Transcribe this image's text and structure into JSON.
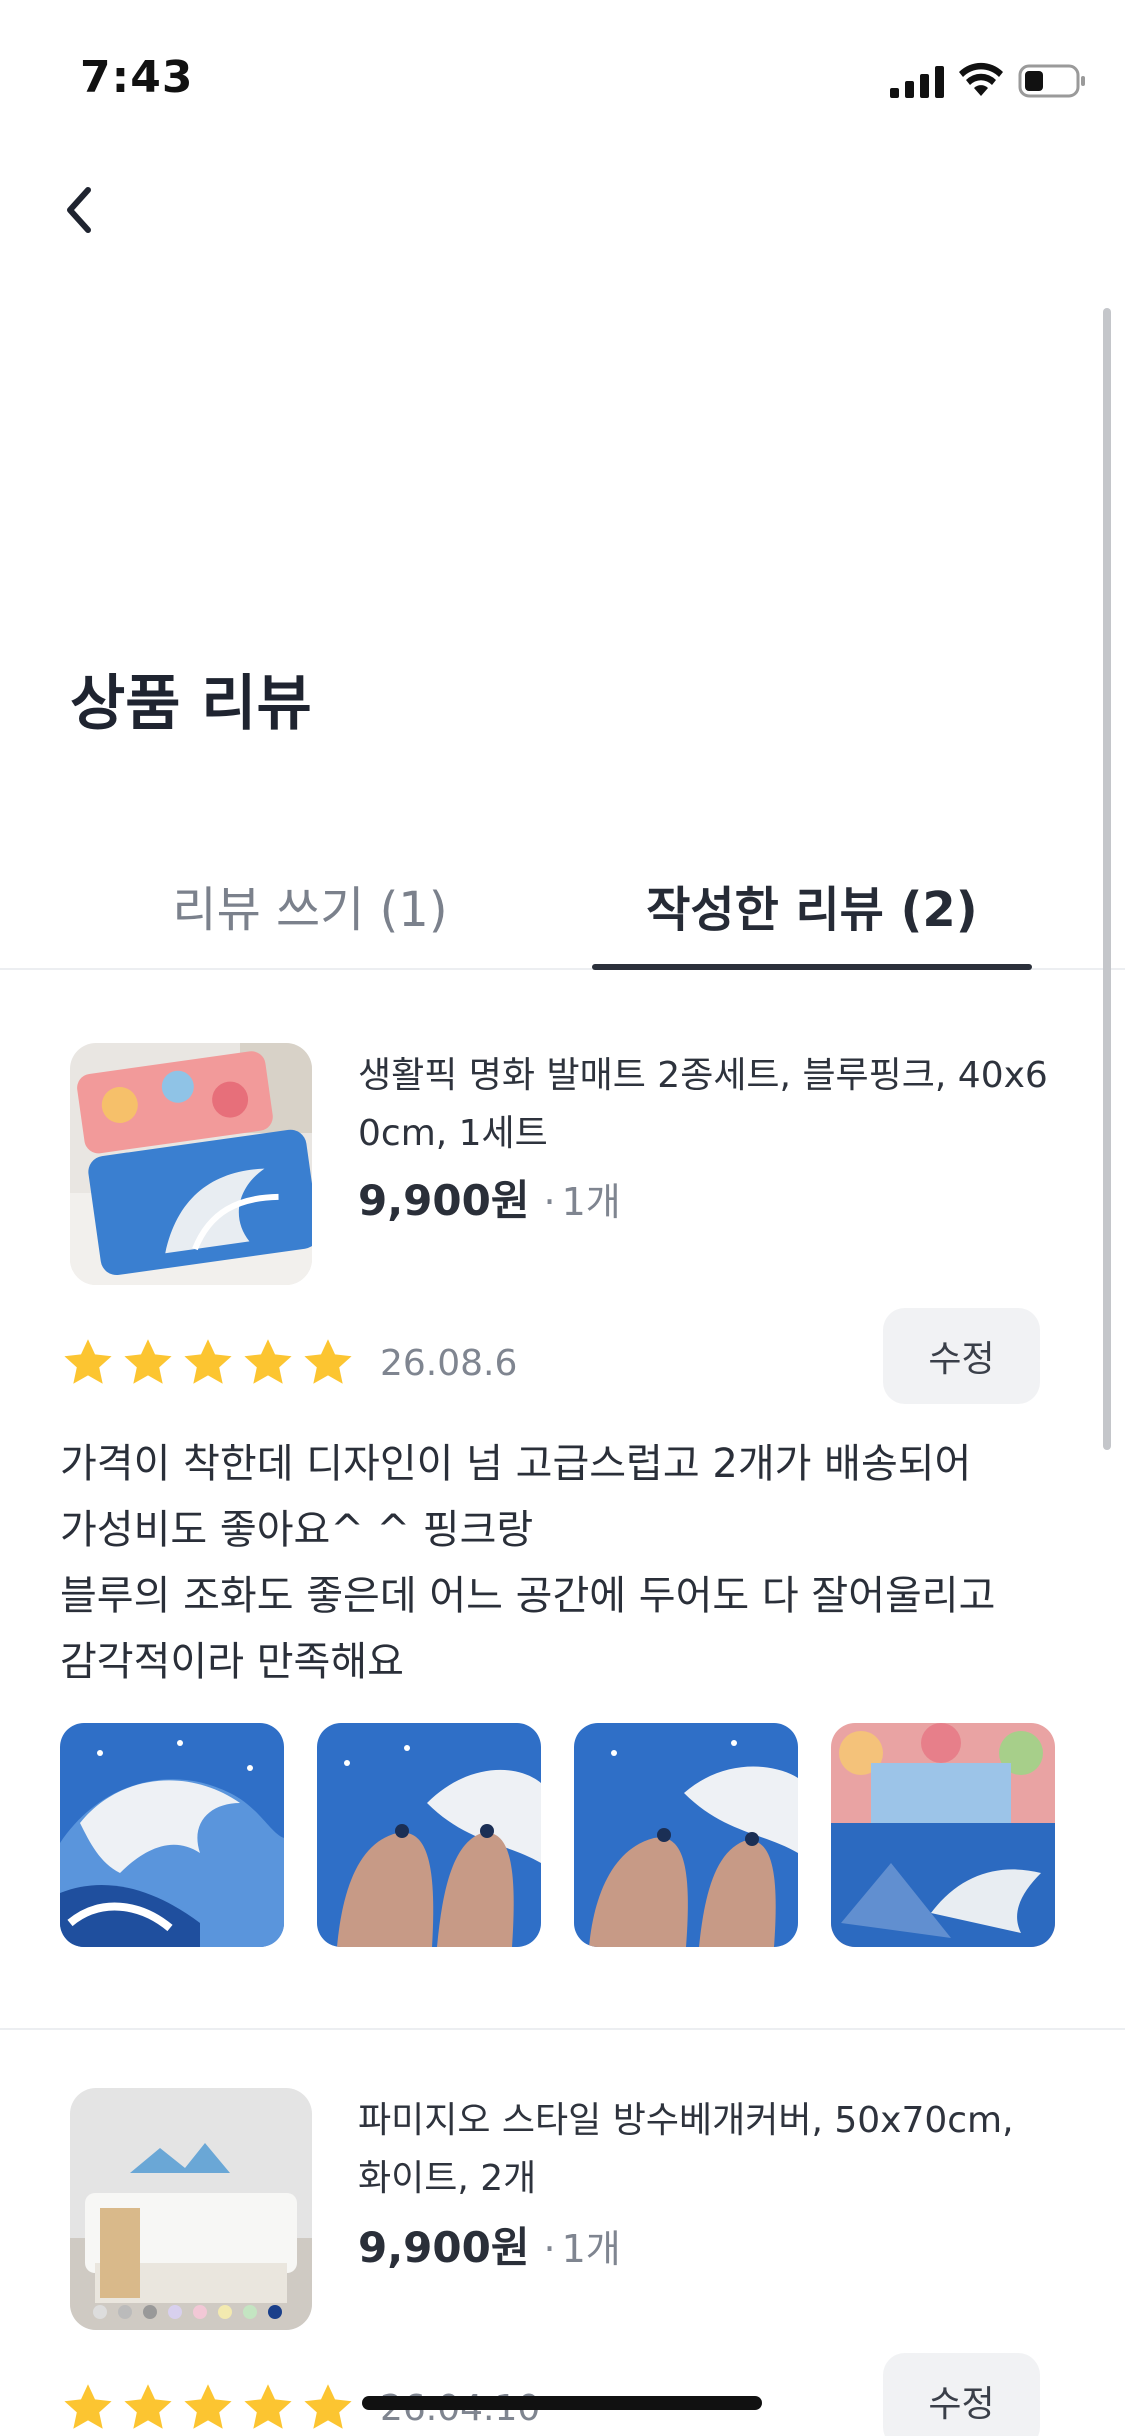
{
  "status_bar": {
    "time": "7:43"
  },
  "page_title": "상품 리뷰",
  "tabs": [
    {
      "label": "리뷰 쓰기 (1)",
      "active": false
    },
    {
      "label": "작성한 리뷰 (2)",
      "active": true
    }
  ],
  "reviews": [
    {
      "product_name": "생활픽 명화 발매트 2종세트, 블루핑크, 40x60cm, 1세트",
      "price": "9,900원",
      "quantity": "1개",
      "rating": 5,
      "date": "26.08.6",
      "edit_label": "수정",
      "text_lines": [
        "가격이 착한데 디자인이 넘 고급스럽고 2개가 배송되어",
        "가성비도 좋아요^ ^ 핑크랑",
        "블루의 조화도 좋은데 어느 공간에 두어도 다 잘어울리고",
        "감각적이라 만족해요"
      ],
      "photo_count": 4
    },
    {
      "product_name": "파미지오 스타일 방수베개커버, 50x70cm, 화이트, 2개",
      "price": "9,900원",
      "quantity": "1개",
      "rating": 5,
      "date": "26.04.10",
      "edit_label": "수정"
    }
  ],
  "colors": {
    "star": "#fcc531",
    "tab_indicator": "#2b303b",
    "muted_text": "#7f8590",
    "edit_button_bg": "#f1f2f4"
  },
  "icons": [
    "back-chevron-icon",
    "cellular-signal-icon",
    "wifi-icon",
    "battery-icon",
    "star-icon"
  ]
}
